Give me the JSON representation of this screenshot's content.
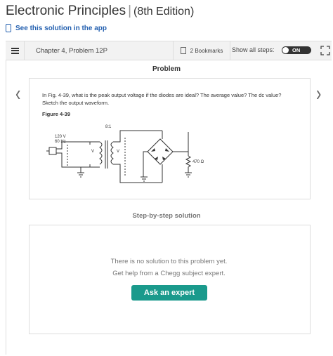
{
  "book": {
    "title": "Electronic Principles",
    "edition": "(8th Edition)"
  },
  "app_link": "See this solution in the app",
  "toolbar": {
    "chapter": "Chapter 4, Problem 12P",
    "bookmarks": "2 Bookmarks",
    "show_steps": "Show all steps:",
    "toggle": "ON"
  },
  "problem": {
    "heading": "Problem",
    "text": "In Fig. 4-39, what is the peak output voltage if the diodes are ideal? The average value? The dc value? Sketch the output waveform.",
    "figure_label": "Figure 4-39",
    "figure": {
      "ratio": "8:1",
      "source": "120 V",
      "freq": "60 Hz",
      "v1": "V",
      "v2": "V",
      "resistor": "470 Ω"
    }
  },
  "solution": {
    "heading": "Step-by-step solution",
    "no_solution": "There is no solution to this problem yet.",
    "get_help": "Get help from a Chegg subject expert.",
    "ask_button": "Ask an expert"
  },
  "colors": {
    "accent": "#1a9a8c",
    "link": "#2561b0"
  }
}
